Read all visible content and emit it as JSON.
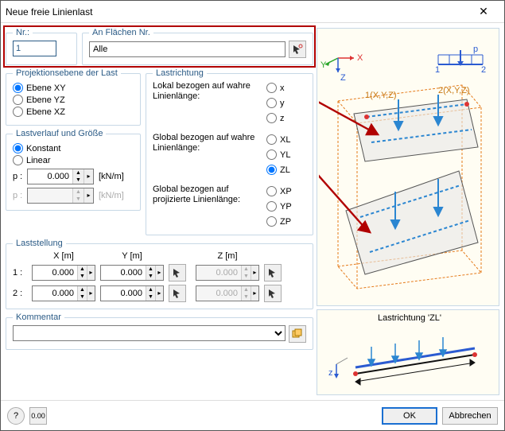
{
  "window": {
    "title": "Neue freie Linienlast"
  },
  "nr": {
    "label": "Nr.:",
    "value": "1"
  },
  "flachen": {
    "label": "An Flächen Nr.",
    "value": "Alle"
  },
  "projektion": {
    "label": "Projektionsebene der Last",
    "xy": "Ebene XY",
    "yz": "Ebene YZ",
    "xz": "Ebene XZ"
  },
  "lastverlauf": {
    "label": "Lastverlauf und Größe",
    "konstant": "Konstant",
    "linear": "Linear",
    "p": "p :",
    "p_val": "0.000",
    "unit": "[kN/m]"
  },
  "lastrichtung": {
    "label": "Lastrichtung",
    "lokal": "Lokal bezogen auf wahre Linienlänge:",
    "global_wahr": "Global bezogen auf wahre Linienlänge:",
    "global_proj": "Global bezogen auf projizierte Linienlänge:",
    "x": "x",
    "y": "y",
    "z": "z",
    "XL": "XL",
    "YL": "YL",
    "ZL": "ZL",
    "XP": "XP",
    "YP": "YP",
    "ZP": "ZP"
  },
  "laststellung": {
    "label": "Laststellung",
    "X": "X  [m]",
    "Y": "Y  [m]",
    "Z": "Z  [m]",
    "r1": "1 :",
    "r2": "2 :",
    "val": "0.000"
  },
  "kommentar": {
    "label": "Kommentar"
  },
  "preview2": {
    "label": "Lastrichtung 'ZL'"
  },
  "buttons": {
    "ok": "OK",
    "cancel": "Abbrechen"
  }
}
